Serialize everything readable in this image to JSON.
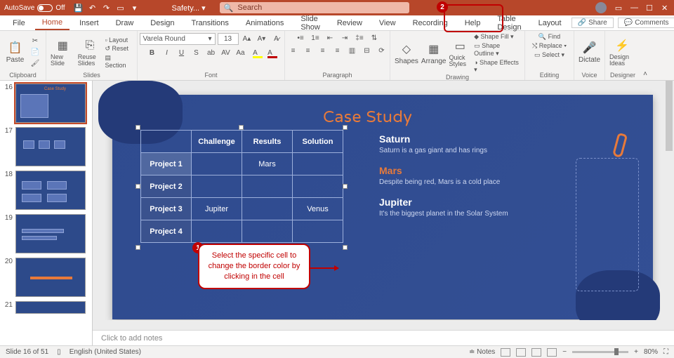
{
  "titlebar": {
    "autosave_label": "AutoSave",
    "autosave_state": "Off",
    "doc_name": "Safety... ▾",
    "search_placeholder": "Search"
  },
  "tabs": {
    "file": "File",
    "home": "Home",
    "insert": "Insert",
    "draw": "Draw",
    "design": "Design",
    "transitions": "Transitions",
    "animations": "Animations",
    "slideshow": "Slide Show",
    "review": "Review",
    "view": "View",
    "recording": "Recording",
    "help": "Help",
    "table_design": "Table Design",
    "layout": "Layout",
    "share": "Share",
    "comments": "Comments"
  },
  "ribbon": {
    "clipboard": {
      "title": "Clipboard",
      "paste": "Paste"
    },
    "slides": {
      "title": "Slides",
      "new_slide": "New Slide",
      "reuse": "Reuse Slides",
      "layout": "Layout",
      "reset": "Reset",
      "section": "Section"
    },
    "font": {
      "title": "Font",
      "family": "Varela Round",
      "size": "13"
    },
    "paragraph": {
      "title": "Paragraph"
    },
    "drawing": {
      "title": "Drawing",
      "shapes": "Shapes",
      "arrange": "Arrange",
      "quick": "Quick Styles",
      "fill": "Shape Fill",
      "outline": "Shape Outline",
      "effects": "Shape Effects"
    },
    "editing": {
      "title": "Editing",
      "find": "Find",
      "replace": "Replace",
      "select": "Select"
    },
    "voice": {
      "title": "Voice",
      "dictate": "Dictate"
    },
    "designer": {
      "title": "Designer",
      "ideas": "Design Ideas"
    }
  },
  "thumbs": {
    "n16": "16",
    "n17": "17",
    "n18": "18",
    "n19": "19",
    "n20": "20",
    "n21": "21"
  },
  "slide": {
    "title": "Case Study",
    "table": {
      "cols": [
        "",
        "Challenge",
        "Results",
        "Solution"
      ],
      "rows": [
        {
          "label": "Project 1",
          "c1": "",
          "c2": "Mars",
          "c3": ""
        },
        {
          "label": "Project 2",
          "c1": "",
          "c2": "",
          "c3": ""
        },
        {
          "label": "Project 3",
          "c1": "Jupiter",
          "c2": "",
          "c3": "Venus"
        },
        {
          "label": "Project 4",
          "c1": "",
          "c2": "",
          "c3": ""
        }
      ]
    },
    "side": {
      "saturn_h": "Saturn",
      "saturn_p": "Saturn is a gas giant and has rings",
      "mars_h": "Mars",
      "mars_p": "Despite being red, Mars is a cold place",
      "jupiter_h": "Jupiter",
      "jupiter_p": "It's the biggest planet in the Solar System"
    }
  },
  "callouts": {
    "c1_num": "1",
    "c1_text": "Select the specific cell to change the border color by clicking in the cell",
    "c2_num": "2"
  },
  "notes_placeholder": "Click to add notes",
  "status": {
    "slide_info": "Slide 16 of 51",
    "language": "English (United States)",
    "notes": "Notes",
    "zoom": "80%"
  }
}
